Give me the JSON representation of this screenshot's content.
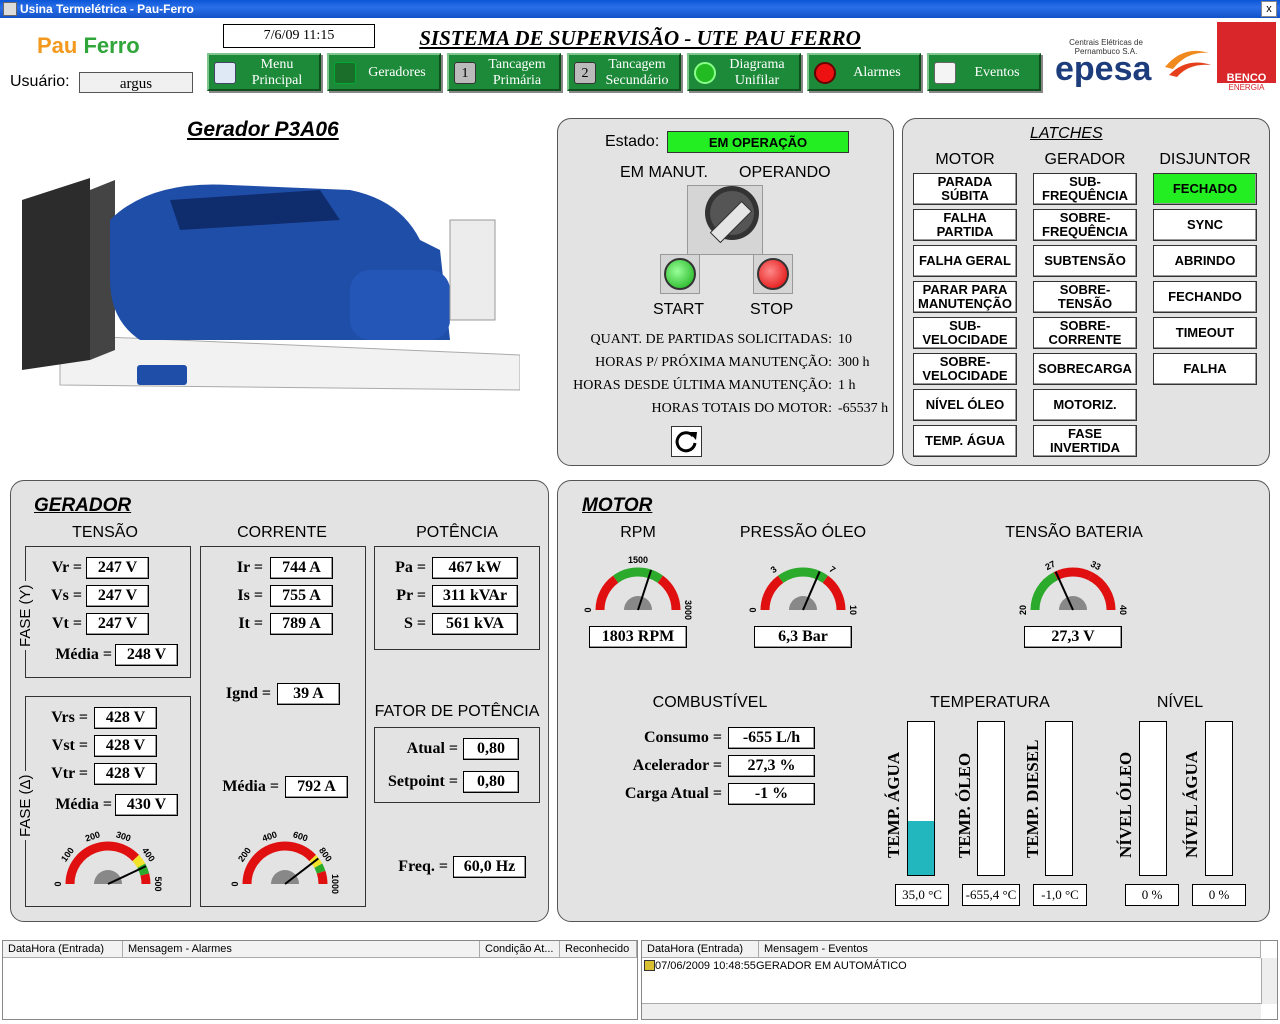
{
  "window": {
    "title": "Usina Termelétrica - Pau-Ferro",
    "close": "x"
  },
  "header": {
    "logo_pau": "Pau",
    "logo_ferro": "Ferro",
    "user_label": "Usuário:",
    "user_value": "argus",
    "datetime": "7/6/09 11:15",
    "system_title": "SISTEMA DE SUPERVISÃO - UTE PAU FERRO",
    "nav": [
      "Menu Principal",
      "Geradores",
      "Tancagem Primária",
      "Tancagem Secundário",
      "Diagrama Unifilar",
      "Alarmes",
      "Eventos"
    ],
    "brand_sub": "Centrais Elétricas de Pernambuco S.A.",
    "brand": "epesa",
    "benco": "BENCO",
    "benco_sub": "ENERGIA"
  },
  "generator": {
    "title": "Gerador P3A06"
  },
  "status": {
    "estado_label": "Estado:",
    "estado_value": "EM OPERAÇÃO",
    "em_manut": "EM MANUT.",
    "operando": "OPERANDO",
    "start": "START",
    "stop": "STOP",
    "stats": [
      {
        "label": "QUANT. DE PARTIDAS SOLICITADAS:",
        "value": "10"
      },
      {
        "label": "HORAS P/ PRÓXIMA MANUTENÇÃO:",
        "value": "300 h"
      },
      {
        "label": "HORAS DESDE ÚLTIMA MANUTENÇÃO:",
        "value": "1 h"
      },
      {
        "label": "HORAS TOTAIS DO MOTOR:",
        "value": "-65537 h"
      }
    ]
  },
  "latches": {
    "title": "LATCHES",
    "motor_hdr": "MOTOR",
    "gerador_hdr": "GERADOR",
    "disjuntor_hdr": "DISJUNTOR",
    "motor": [
      "PARADA SÚBITA",
      "FALHA PARTIDA",
      "FALHA GERAL",
      "PARAR PARA MANUTENÇÃO",
      "SUB-VELOCIDADE",
      "SOBRE-VELOCIDADE",
      "NÍVEL ÓLEO",
      "TEMP. ÁGUA"
    ],
    "gerador": [
      "SUB-FREQUÊNCIA",
      "SOBRE-FREQUÊNCIA",
      "SUBTENSÃO",
      "SOBRE-TENSÃO",
      "SOBRE-CORRENTE",
      "SOBRECARGA",
      "MOTORIZ.",
      "FASE INVERTIDA"
    ],
    "disjuntor": [
      "FECHADO",
      "SYNC",
      "ABRINDO",
      "FECHANDO",
      "TIMEOUT",
      "FALHA"
    ],
    "active_color": "#22ee22"
  },
  "gerador": {
    "title": "GERADOR",
    "tensao": "TENSÃO",
    "corrente": "CORRENTE",
    "potencia": "POTÊNCIA",
    "fase_y": "FASE (Y)",
    "fase_d": "FASE (Δ)",
    "vr_l": "Vr =",
    "vr": "247 V",
    "vs_l": "Vs =",
    "vs": "247 V",
    "vt_l": "Vt =",
    "vt": "247 V",
    "media_l": "Média =",
    "media_y": "248 V",
    "vrs_l": "Vrs =",
    "vrs": "428 V",
    "vst_l": "Vst =",
    "vst": "428 V",
    "vtr_l": "Vtr =",
    "vtr": "428 V",
    "media_d": "430 V",
    "ir_l": "Ir =",
    "ir": "744 A",
    "is_l": "Is =",
    "is": "755 A",
    "it_l": "It =",
    "it": "789 A",
    "ignd_l": "Ignd =",
    "ignd": "39 A",
    "media_i": "792 A",
    "pa_l": "Pa =",
    "pa": "467 kW",
    "pr_l": "Pr =",
    "pr": "311 kVAr",
    "s_l": "S =",
    "s": "561 kVA",
    "fp_title": "FATOR DE POTÊNCIA",
    "atual_l": "Atual =",
    "atual": "0,80",
    "setpoint_l": "Setpoint =",
    "setpoint": "0,80",
    "freq_l": "Freq. =",
    "freq": "60,0 Hz",
    "gauge_v_ticks": [
      "0",
      "100",
      "200",
      "300",
      "400",
      "500"
    ],
    "gauge_v_value": 430,
    "gauge_i_ticks": [
      "0",
      "200",
      "400",
      "600",
      "800",
      "1000"
    ],
    "gauge_i_value": 792
  },
  "motor": {
    "title": "MOTOR",
    "rpm_hdr": "RPM",
    "oil_hdr": "PRESSÃO ÓLEO",
    "bat_hdr": "TENSÃO BATERIA",
    "rpm": "1803 RPM",
    "rpm_ticks": [
      "0",
      "1500",
      "3000"
    ],
    "rpm_value": 1803,
    "oil": "6,3 Bar",
    "oil_ticks": [
      "0",
      "3",
      "7",
      "10"
    ],
    "oil_value": 6.3,
    "bat": "27,3 V",
    "bat_ticks": [
      "20",
      "27",
      "33",
      "40"
    ],
    "bat_value": 27.3,
    "comb_hdr": "COMBUSTÍVEL",
    "consumo_l": "Consumo =",
    "consumo": "-655 L/h",
    "acel_l": "Acelerador =",
    "acel": "27,3 %",
    "carga_l": "Carga Atual =",
    "carga": "-1 %",
    "temp_hdr": "TEMPERATURA",
    "nivel_hdr": "NÍVEL",
    "bars": [
      {
        "label": "TEMP. ÁGUA",
        "value": "35,0 °C",
        "fill": 0.35
      },
      {
        "label": "TEMP. ÓLEO",
        "value": "-655,4 °C",
        "fill": 0
      },
      {
        "label": "TEMP. DIESEL",
        "value": "-1,0 °C",
        "fill": 0
      },
      {
        "label": "NÍVEL ÓLEO",
        "value": "0 %",
        "fill": 0
      },
      {
        "label": "NÍVEL ÁGUA",
        "value": "0 %",
        "fill": 0
      }
    ]
  },
  "alarms_table": {
    "cols": [
      "DataHora (Entrada)",
      "Mensagem - Alarmes",
      "Condição At...",
      "Reconhecido"
    ]
  },
  "events_table": {
    "cols": [
      "DataHora (Entrada)",
      "Mensagem - Eventos"
    ],
    "row_date": "07/06/2009 10:48:55",
    "row_msg": "GERADOR EM AUTOMÁTICO"
  }
}
